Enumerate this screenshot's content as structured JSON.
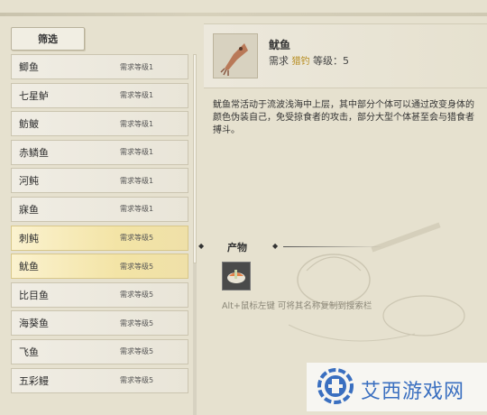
{
  "filter": {
    "label": "筛选"
  },
  "list": [
    {
      "name": "鲫鱼",
      "req": "需求等级1",
      "hl": false
    },
    {
      "name": "七星鲈",
      "req": "需求等级1",
      "hl": false
    },
    {
      "name": "鲂鲏",
      "req": "需求等级1",
      "hl": false
    },
    {
      "name": "赤鳞鱼",
      "req": "需求等级1",
      "hl": false
    },
    {
      "name": "河鲀",
      "req": "需求等级1",
      "hl": false
    },
    {
      "name": "寐鱼",
      "req": "需求等级1",
      "hl": false
    },
    {
      "name": "刺鲀",
      "req": "需求等级5",
      "hl": true
    },
    {
      "name": "鱿鱼",
      "req": "需求等级5",
      "hl": true
    },
    {
      "name": "比目鱼",
      "req": "需求等级5",
      "hl": false
    },
    {
      "name": "海葵鱼",
      "req": "需求等级5",
      "hl": false
    },
    {
      "name": "飞鱼",
      "req": "需求等级5",
      "hl": false
    },
    {
      "name": "五彩鳗",
      "req": "需求等级5",
      "hl": false
    }
  ],
  "detail": {
    "name": "鱿鱼",
    "req_prefix": "需求",
    "tool": "猎钓",
    "req_suffix": "等级：5",
    "icon": "squid-icon",
    "description": "鱿鱼常活动于流波浅海中上层，其中部分个体可以通过改变身体的颜色伪装自己，免受掠食者的攻击，部分大型个体甚至会与猎食者搏斗。"
  },
  "products": {
    "label": "产物",
    "item_icon": "sushi-icon",
    "hint": "Alt+鼠标左键 可将其名称复制到搜索栏"
  },
  "watermark": {
    "text": "艾西游戏网"
  },
  "colors": {
    "highlight": "#f3e4a6",
    "watermark": "#3a6fc0",
    "tool": "#b58a1a"
  }
}
